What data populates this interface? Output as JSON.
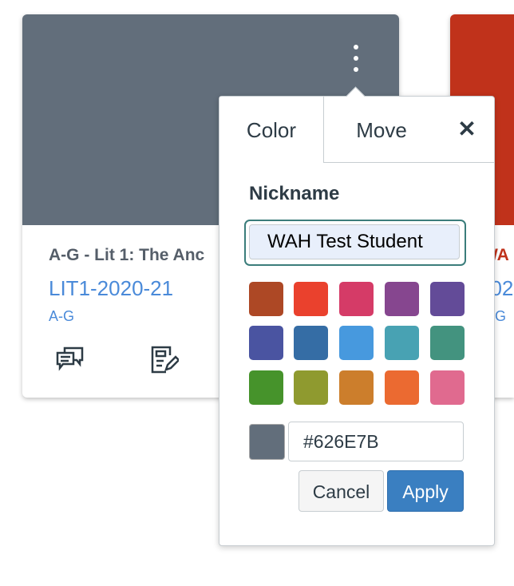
{
  "cards": [
    {
      "color": "#626E7B",
      "title": "A-G - Lit 1: The Anc",
      "code": "LIT1-2020-21",
      "term": "A-G"
    },
    {
      "color": "#C0321B",
      "title": "WA",
      "code": "202",
      "term": "G"
    }
  ],
  "popover": {
    "tabs": [
      "Color",
      "Move"
    ],
    "close_label": "✕",
    "nickname_label": "Nickname",
    "nickname_value": "WAH Test Student",
    "swatches": [
      "#AD4825",
      "#EA412D",
      "#D53B67",
      "#86468F",
      "#634B98",
      "#4A54A1",
      "#356DA5",
      "#4799DE",
      "#48A2B3",
      "#43937F",
      "#46932B",
      "#8F9A2F",
      "#CC7E2C",
      "#EB6A31",
      "#E06A8F"
    ],
    "current_color": "#626E7B",
    "hex_value": "#626E7B",
    "cancel_label": "Cancel",
    "apply_label": "Apply"
  }
}
